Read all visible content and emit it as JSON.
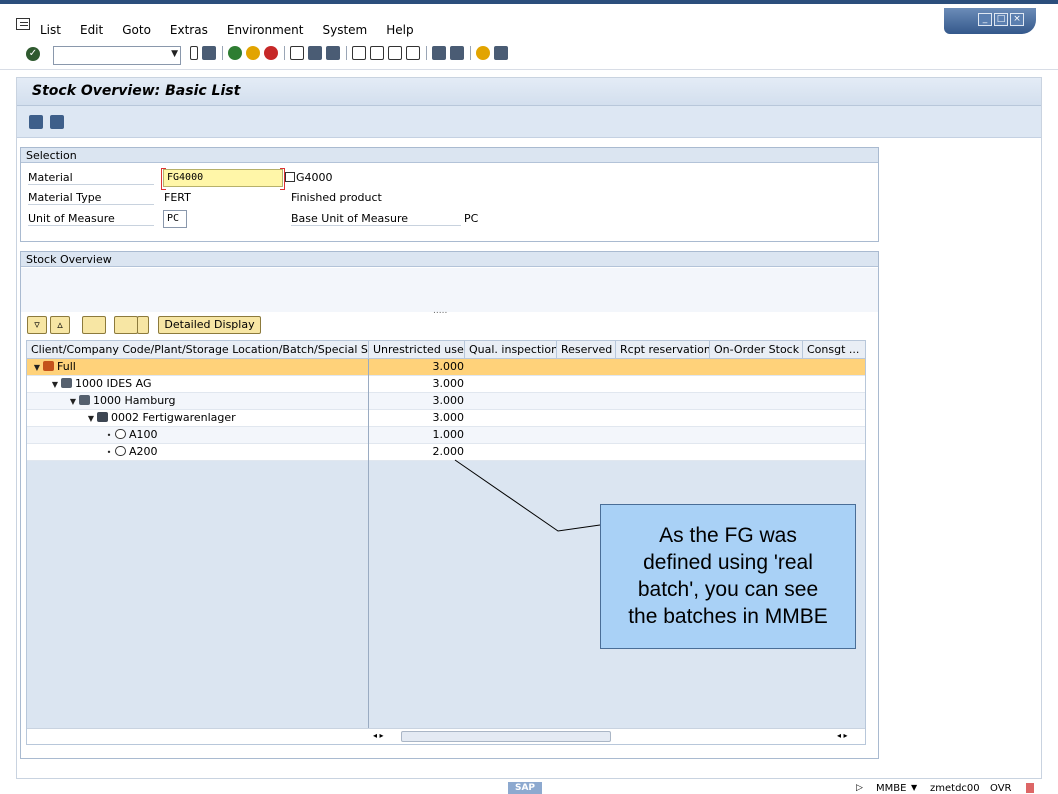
{
  "menu": [
    "List",
    "Edit",
    "Goto",
    "Extras",
    "Environment",
    "System",
    "Help"
  ],
  "title": "Stock Overview: Basic List",
  "selection": {
    "header": "Selection",
    "material_label": "Material",
    "material_value": "FG4000",
    "material_desc": "G4000",
    "material_type_label": "Material Type",
    "material_type_value": "FERT",
    "material_type_desc": "Finished product",
    "uom_label": "Unit of Measure",
    "uom_value": "PC",
    "base_uom_label": "Base Unit of Measure",
    "base_uom_value": "PC"
  },
  "stock": {
    "header": "Stock Overview",
    "dots": ".....",
    "detailed_display_label": "Detailed Display",
    "columns": [
      "Client/Company Code/Plant/Storage Location/Batch/Special Stock",
      "Unrestricted use",
      "Qual. inspection",
      "Reserved",
      "Rcpt reservation",
      "On-Order Stock",
      "Consgt ..."
    ],
    "rows": [
      {
        "name": "Full",
        "qty": "3.000"
      },
      {
        "name": "1000 IDES AG",
        "qty": "3.000"
      },
      {
        "name": "1000 Hamburg",
        "qty": "3.000"
      },
      {
        "name": "0002 Fertigwarenlager",
        "qty": "3.000"
      },
      {
        "name": "A100",
        "qty": "1.000"
      },
      {
        "name": "A200",
        "qty": "2.000"
      }
    ]
  },
  "callout": {
    "line1": "As the FG was",
    "line2": "defined using 'real",
    "line3": "batch', you can see",
    "line4": "the batches in MMBE"
  },
  "status": {
    "system": "MMBE",
    "server": "zmetdc00",
    "mode": "OVR",
    "logo": "SAP"
  }
}
